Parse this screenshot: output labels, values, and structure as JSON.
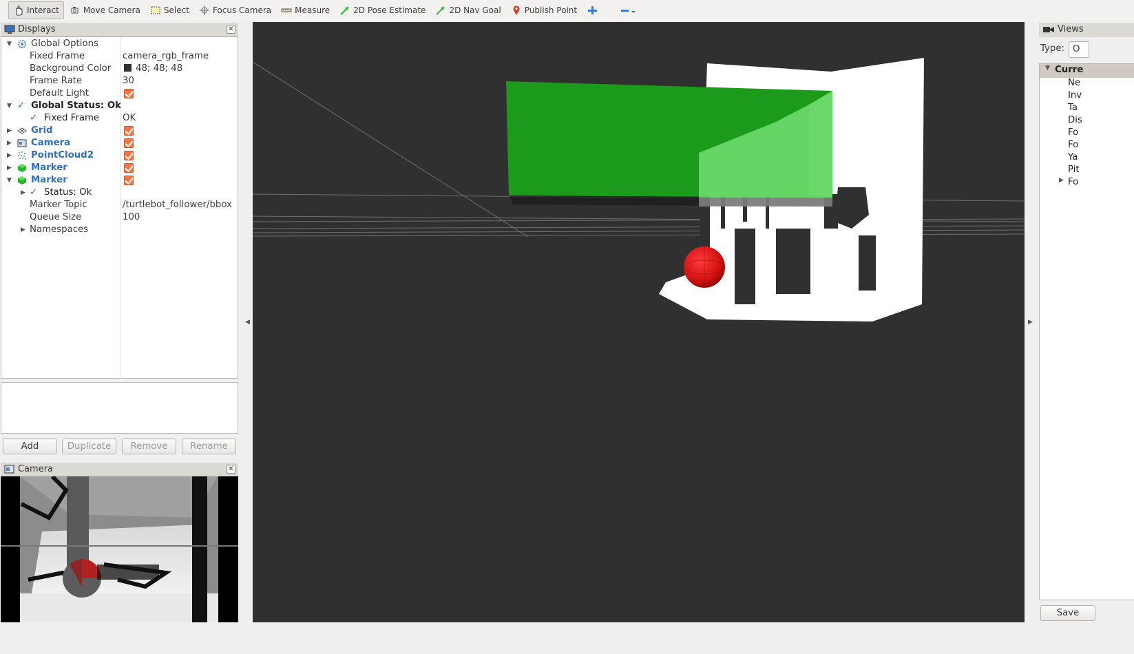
{
  "toolbar": {
    "interact": "Interact",
    "move_camera": "Move Camera",
    "select": "Select",
    "focus_camera": "Focus Camera",
    "measure": "Measure",
    "pose_estimate": "2D Pose Estimate",
    "nav_goal": "2D Nav Goal",
    "publish_point": "Publish Point"
  },
  "displays": {
    "title": "Displays",
    "global_options": "Global Options",
    "fixed_frame_label": "Fixed Frame",
    "fixed_frame_value": "camera_rgb_frame",
    "background_color_label": "Background Color",
    "background_color_value": "48; 48; 48",
    "frame_rate_label": "Frame Rate",
    "frame_rate_value": "30",
    "default_light_label": "Default Light",
    "global_status": "Global Status: Ok",
    "fixed_frame_status_label": "Fixed Frame",
    "fixed_frame_status_value": "OK",
    "grid": "Grid",
    "camera": "Camera",
    "pointcloud2": "PointCloud2",
    "marker1": "Marker",
    "marker2": "Marker",
    "status_ok": "Status: Ok",
    "marker_topic_label": "Marker Topic",
    "marker_topic_value": "/turtlebot_follower/bbox",
    "queue_size_label": "Queue Size",
    "queue_size_value": "100",
    "namespaces": "Namespaces"
  },
  "buttons": {
    "add": "Add",
    "duplicate": "Duplicate",
    "remove": "Remove",
    "rename": "Rename"
  },
  "camera_panel": {
    "title": "Camera"
  },
  "views": {
    "title": "Views",
    "type_label": "Type:",
    "type_value": "O",
    "current": "Curre",
    "items": [
      "Ne",
      "Inv",
      "Ta",
      "Dis",
      "Fo",
      "Fo",
      "Ya",
      "Pit",
      "Fo"
    ],
    "save": "Save"
  },
  "colors": {
    "background": "#303030",
    "marker_box": "#2aa52a",
    "sphere": "#e01010",
    "checkbox": "#f07746"
  }
}
